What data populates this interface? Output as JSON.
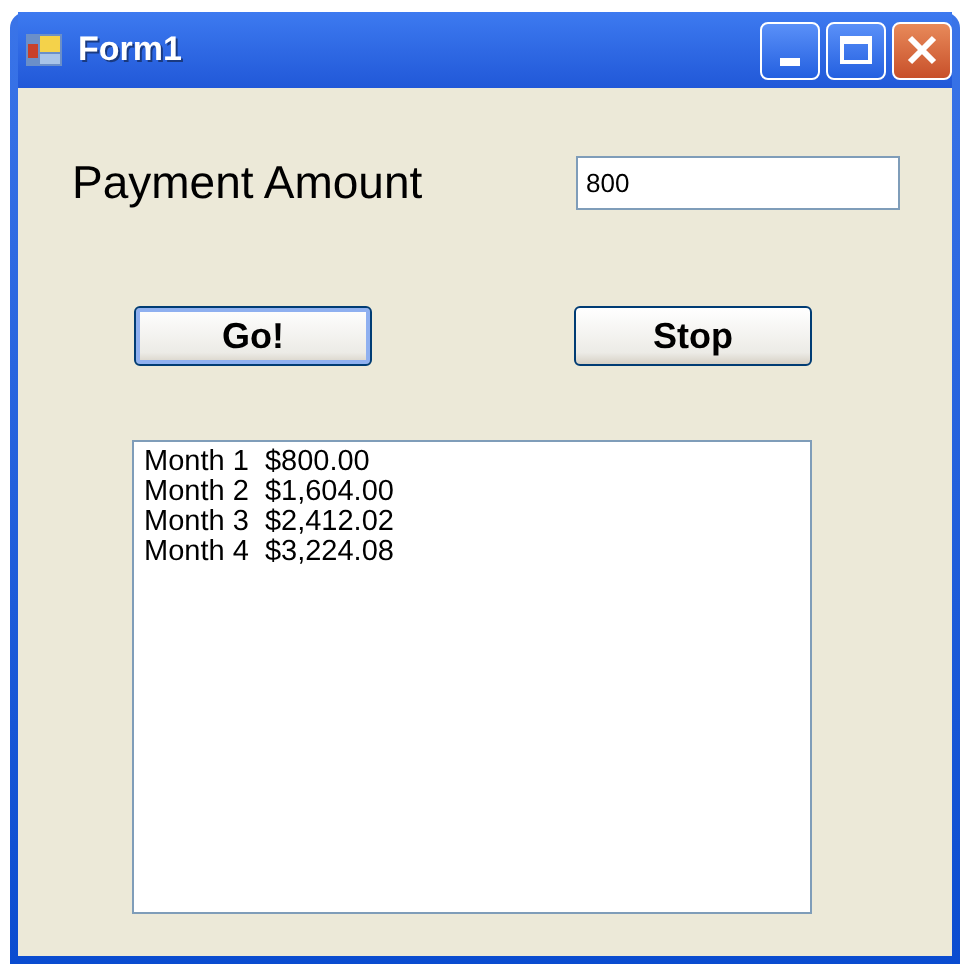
{
  "window": {
    "title": "Form1"
  },
  "payment": {
    "label": "Payment Amount",
    "value": "800"
  },
  "buttons": [
    {
      "label": "Go!",
      "default": true
    },
    {
      "label": "Stop",
      "default": false
    }
  ],
  "list": [
    {
      "month": "Month 1",
      "amount": "$800.00"
    },
    {
      "month": "Month 2",
      "amount": "$1,604.00"
    },
    {
      "month": "Month 3",
      "amount": "$2,412.02"
    },
    {
      "month": "Month 4",
      "amount": "$3,224.08"
    }
  ]
}
